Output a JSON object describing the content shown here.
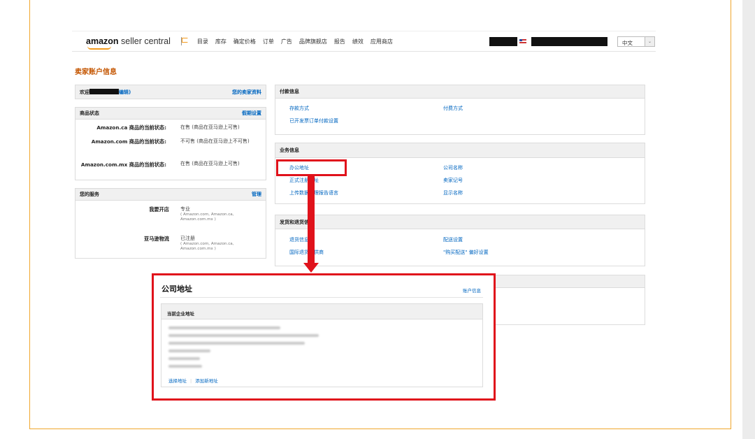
{
  "nav": {
    "logo_bold": "amazon",
    "logo_rest": " seller central",
    "links": [
      "目录",
      "库存",
      "确定价格",
      "订单",
      "广告",
      "品牌旗舰店",
      "报告",
      "绩效",
      "应用商店"
    ],
    "language": "中文",
    "language_arrow": "⌄"
  },
  "page": {
    "title": "卖家账户信息"
  },
  "welcome_panel": {
    "greeting": "欢迎",
    "edit_link": "编辑)",
    "profile_link": "您的卖家资料"
  },
  "listing_status": {
    "title": "商品状态",
    "action": "假期设置",
    "rows": [
      {
        "label": "Amazon.ca 商品的当前状态:",
        "value": "在售 (商品在亚马逊上可售)"
      },
      {
        "label": "Amazon.com 商品的当前状态:",
        "value": "不可售 (商品在亚马逊上不可售)"
      },
      {
        "label": "Amazon.com.mx 商品的当前状态:",
        "value": "在售 (商品在亚马逊上可售)"
      }
    ]
  },
  "services": {
    "title": "您的服务",
    "action": "管理",
    "rows": [
      {
        "label": "我要开店",
        "value": "专业",
        "sub": "( Amazon.com, Amazon.ca, Amazon.com.mx )"
      },
      {
        "label": "亚马逊物流",
        "value": "已注册",
        "sub": "( Amazon.com, Amazon.ca, Amazon.com.mx )"
      }
    ]
  },
  "payment": {
    "title": "付款信息",
    "left_links": [
      "存款方式",
      "已开发票订单付款设置"
    ],
    "right_links": [
      "付费方式"
    ]
  },
  "business": {
    "title": "业务信息",
    "left_links": [
      "办公地址",
      "正式注册地址",
      "上传数据处理报告语言"
    ],
    "right_links": [
      "公司名称",
      "卖家记号",
      "显示名称"
    ]
  },
  "shipping": {
    "title": "发货和退货信息",
    "left_links": [
      "退货信息",
      "国际退货提供商"
    ],
    "right_links": [
      "配送设置",
      "\"购买配送\" 偏好设置"
    ]
  },
  "popup": {
    "title": "公司地址",
    "account_link": "账户信息",
    "section_title": "当前企业地址",
    "choose_link": "选择地址",
    "add_link": "添加新地址",
    "separator": "|"
  },
  "colors": {
    "accent": "#c45500",
    "link": "#0066c0",
    "highlight": "#e0121b",
    "frame": "#f0a62c"
  }
}
